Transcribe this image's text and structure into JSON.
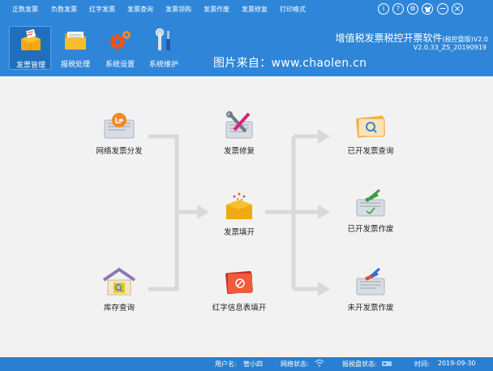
{
  "menubar": {
    "items": [
      "正数发票",
      "负数发票",
      "红字发票",
      "发票查询",
      "发票领购",
      "发票作废",
      "发票修复",
      "打印格式"
    ]
  },
  "window_buttons": {
    "about": "i",
    "help": "?",
    "settings": "⚙",
    "minimize": "−",
    "close": "×"
  },
  "toolbar": {
    "items": [
      "发票管理",
      "报税处理",
      "系统设置",
      "系统维护"
    ],
    "active": "发票管理"
  },
  "app": {
    "title": "增值税发票税控开票软件",
    "edition": "(税控盘版)V2.0",
    "version": "V2.0.33_ZS_20190919"
  },
  "watermark": "图片来自：www.chaolen.cn",
  "flow": {
    "nodes": {
      "distribute": "网络发票分发",
      "stock_query": "库存查询",
      "repair": "发票修复",
      "fill": "发票填开",
      "red_info": "红字信息表填开",
      "issued_query": "已开发票查询",
      "issued_void": "已开发票作废",
      "unissued_void": "未开发票作废"
    }
  },
  "statusbar": {
    "user_label": "用户名:",
    "user_value": "管小四",
    "network_label": "网络状态:",
    "disk_label": "报税盘状态:",
    "time_label": "时间:",
    "time_value": "2019-09-30"
  },
  "colors": {
    "header_bg": "#2f86d8",
    "statusbar_bg": "#2a7fd0",
    "main_bg": "#f2f2f2",
    "flow_line": "#d9d9d9"
  }
}
